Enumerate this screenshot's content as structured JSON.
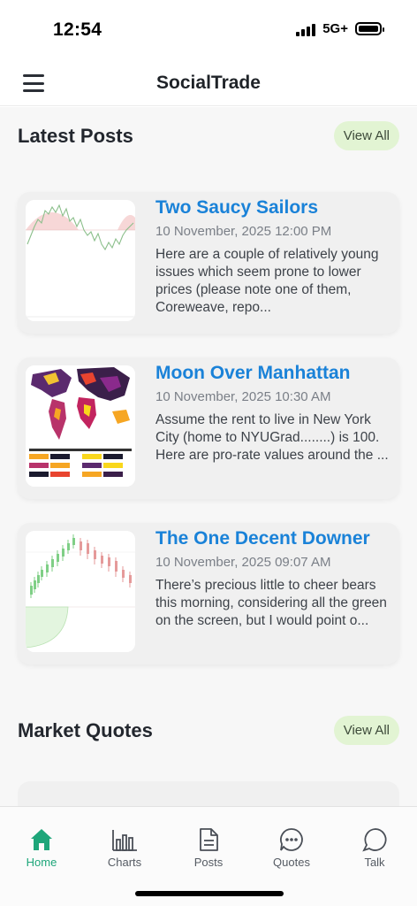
{
  "status_bar": {
    "time": "12:54",
    "network": "5G+",
    "battery_icon": "battery-full-icon",
    "signal_icon": "signal-bars-icon"
  },
  "header": {
    "title": "SocialTrade",
    "menu_icon": "hamburger-menu-icon"
  },
  "latest_posts": {
    "title": "Latest Posts",
    "view_all_label": "View All",
    "posts": [
      {
        "title": "Two Saucy Sailors",
        "date": "10 November, 2025 12:00 PM",
        "excerpt": "Here are a couple of relatively young issues which seem prone to lower prices (please note one of them, Coreweave, repo...",
        "thumbnail": "stock-chart-thumbnail"
      },
      {
        "title": "Moon Over Manhattan",
        "date": "10 November, 2025 10:30 AM",
        "excerpt": "Assume the rent to live in New York City (home to NYUGrad........) is 100. Here are pro-rate values around the ...",
        "thumbnail": "world-map-thumbnail"
      },
      {
        "title": "The One Decent Downer",
        "date": "10 November, 2025 09:07 AM",
        "excerpt": "There’s precious little to cheer bears this morning, considering all the green on the screen, but I would point o...",
        "thumbnail": "candlestick-chart-thumbnail"
      }
    ]
  },
  "market_quotes": {
    "title": "Market Quotes",
    "view_all_label": "View All"
  },
  "bottom_nav": {
    "items": [
      {
        "label": "Home",
        "icon": "home-icon",
        "active": true
      },
      {
        "label": "Charts",
        "icon": "bar-chart-icon",
        "active": false
      },
      {
        "label": "Posts",
        "icon": "document-icon",
        "active": false
      },
      {
        "label": "Quotes",
        "icon": "chat-dots-icon",
        "active": false
      },
      {
        "label": "Talk",
        "icon": "chat-bubble-icon",
        "active": false
      }
    ]
  },
  "colors": {
    "accent": "#1ea67a",
    "link": "#1a82d8",
    "view_all_bg": "#e2f4d3"
  }
}
